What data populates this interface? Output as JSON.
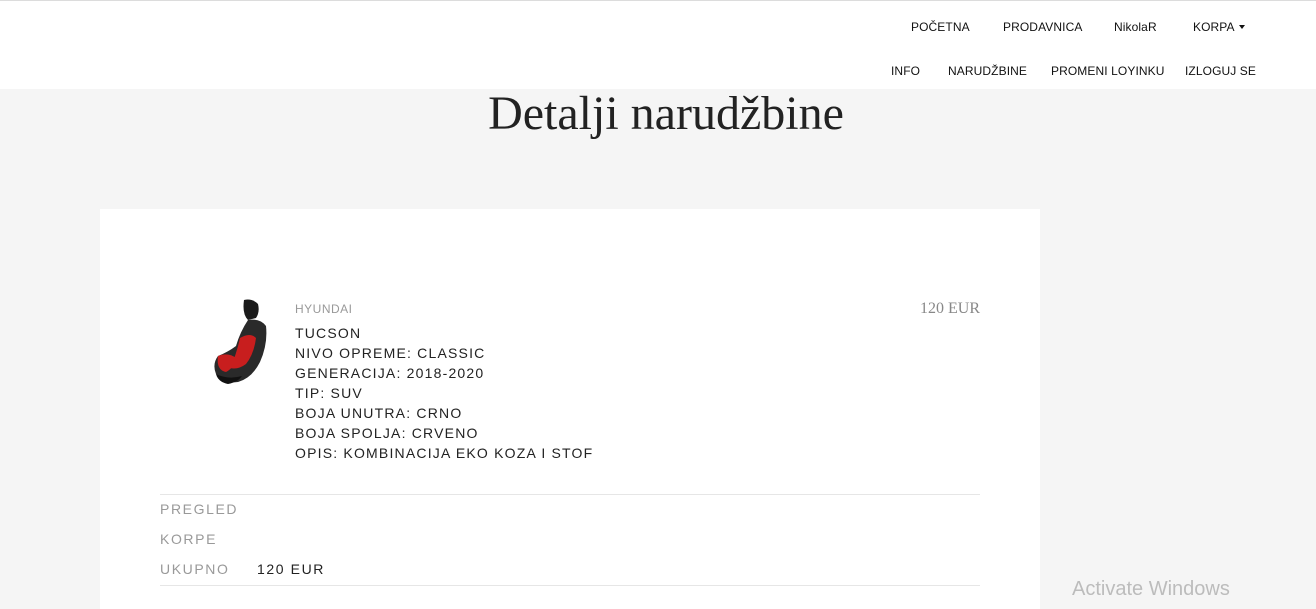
{
  "nav": {
    "top": [
      "POČETNA",
      "PRODAVNICA",
      "NikolaR",
      "KORPA"
    ],
    "bottom": [
      "INFO",
      "NARUDŽBINE",
      "PROMENI LOYINKU",
      "IZLOGUJ SE"
    ]
  },
  "page": {
    "title": "Detalji narudžbine"
  },
  "order": {
    "item": {
      "brand": "HYUNDAI",
      "price": "120 EUR",
      "lines": [
        "TUCSON",
        "NIVO OPREME: CLASSIC",
        "GENERACIJA: 2018-2020",
        "TIP: SUV",
        "BOJA UNUTRA: CRNO",
        "BOJA SPOLJA: CRVENO",
        "OPIS: KOMBINACIJA EKO KOZA I STOF"
      ]
    },
    "summary": {
      "label_line1": "PREGLED",
      "label_line2": "KORPE",
      "total_label": "UKUPNO",
      "total_value": "120 EUR"
    }
  },
  "watermark": "Activate Windows",
  "colors": {
    "background": "#f5f5f5",
    "panel": "#ffffff",
    "muted_text": "#999999",
    "seat_red": "#c81e1e"
  }
}
